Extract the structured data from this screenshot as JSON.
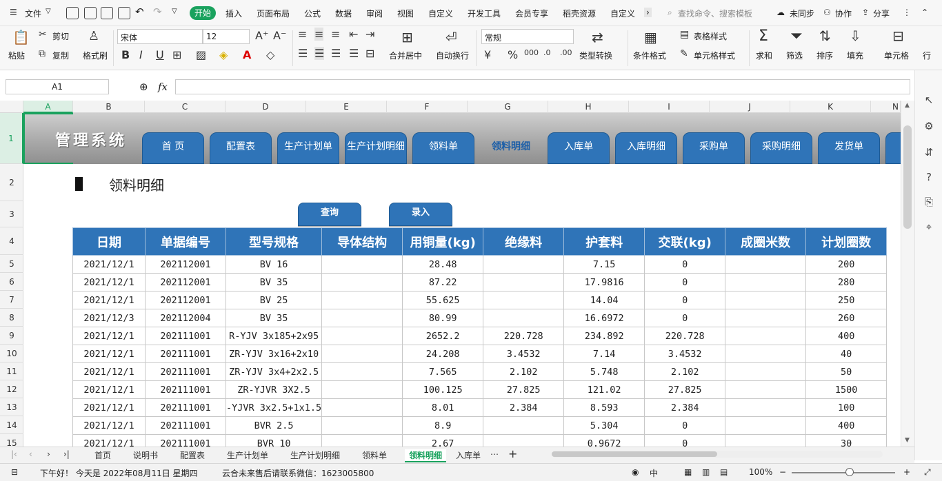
{
  "menubar": {
    "file_label": "文件",
    "tabs": [
      "开始",
      "插入",
      "页面布局",
      "公式",
      "数据",
      "审阅",
      "视图",
      "自定义",
      "开发工具",
      "会员专享",
      "稻壳资源",
      "自定义"
    ],
    "search_placeholder": "查找命令、搜索模板",
    "sync_label": "未同步",
    "collab_label": "协作",
    "share_label": "分享"
  },
  "ribbon": {
    "paste": "粘贴",
    "cut": "剪切",
    "copy": "复制",
    "format_painter": "格式刷",
    "font_name": "宋体",
    "font_size": "12",
    "merge_center": "合并居中",
    "wrap": "自动换行",
    "number_format": "常规",
    "type_convert": "类型转换",
    "cond_format": "条件格式",
    "table_style": "表格样式",
    "cell_style": "单元格样式",
    "sum": "求和",
    "filter": "筛选",
    "sort": "排序",
    "fill": "填充",
    "cell": "单元格",
    "row_col": "行"
  },
  "formula_bar": {
    "name_box": "A1",
    "fx": "fx",
    "formula": ""
  },
  "columns": [
    "A",
    "B",
    "C",
    "D",
    "E",
    "F",
    "G",
    "H",
    "I",
    "J",
    "K",
    "N"
  ],
  "rows": [
    "1",
    "2",
    "3",
    "4",
    "5",
    "6",
    "7",
    "8",
    "9",
    "10",
    "11",
    "12",
    "13",
    "14",
    "15"
  ],
  "banner": {
    "brand": "管理系统",
    "nav": [
      "首 页",
      "配置表",
      "生产计划单",
      "生产计划明细",
      "领料单",
      "领料明细",
      "入库单",
      "入库明细",
      "采购单",
      "采购明细",
      "发货单"
    ],
    "active_nav": "领料明细"
  },
  "section_title": "领料明细",
  "actions": {
    "query": "查询",
    "entry": "录入"
  },
  "table": {
    "headers": [
      "日期",
      "单据编号",
      "型号规格",
      "导体结构",
      "用铜量(kg)",
      "绝缘料",
      "护套料",
      "交联(kg)",
      "成圈米数",
      "计划圈数"
    ],
    "rows": [
      [
        "2021/12/1",
        "202112001",
        "BV 16",
        "",
        "28.48",
        "",
        "7.15",
        "0",
        "",
        "200"
      ],
      [
        "2021/12/1",
        "202112001",
        "BV 35",
        "",
        "87.22",
        "",
        "17.9816",
        "0",
        "",
        "280"
      ],
      [
        "2021/12/1",
        "202112001",
        "BV 25",
        "",
        "55.625",
        "",
        "14.04",
        "0",
        "",
        "250"
      ],
      [
        "2021/12/3",
        "202112004",
        "BV 35",
        "",
        "80.99",
        "",
        "16.6972",
        "0",
        "",
        "260"
      ],
      [
        "2021/12/1",
        "202111001",
        "R-YJV 3x185+2x95",
        "",
        "2652.2",
        "220.728",
        "234.892",
        "220.728",
        "",
        "400"
      ],
      [
        "2021/12/1",
        "202111001",
        "ZR-YJV 3x16+2x10",
        "",
        "24.208",
        "3.4532",
        "7.14",
        "3.4532",
        "",
        "40"
      ],
      [
        "2021/12/1",
        "202111001",
        "ZR-YJV 3x4+2x2.5",
        "",
        "7.565",
        "2.102",
        "5.748",
        "2.102",
        "",
        "50"
      ],
      [
        "2021/12/1",
        "202111001",
        "ZR-YJVR 3X2.5",
        "",
        "100.125",
        "27.825",
        "121.02",
        "27.825",
        "",
        "1500"
      ],
      [
        "2021/12/1",
        "202111001",
        "-YJVR 3x2.5+1x1.5",
        "",
        "8.01",
        "2.384",
        "8.593",
        "2.384",
        "",
        "100"
      ],
      [
        "2021/12/1",
        "202111001",
        "BVR 2.5",
        "",
        "8.9",
        "",
        "5.304",
        "0",
        "",
        "400"
      ],
      [
        "2021/12/1",
        "202111001",
        "BVR 10",
        "",
        "2.67",
        "",
        "0.9672",
        "0",
        "",
        "30"
      ]
    ]
  },
  "sheet_tabs": [
    "首页",
    "说明书",
    "配置表",
    "生产计划单",
    "生产计划明细",
    "领料单",
    "领料明细",
    "入库单"
  ],
  "active_sheet": "领料明细",
  "status": {
    "greeting": "下午好！ 今天是 2022年08月11日 星期四",
    "notice": "云合未来售后请联系微信：1623005800",
    "zoom": "100%"
  },
  "colors": {
    "accent_green": "#1aa25e",
    "header_blue": "#2f74b8"
  }
}
